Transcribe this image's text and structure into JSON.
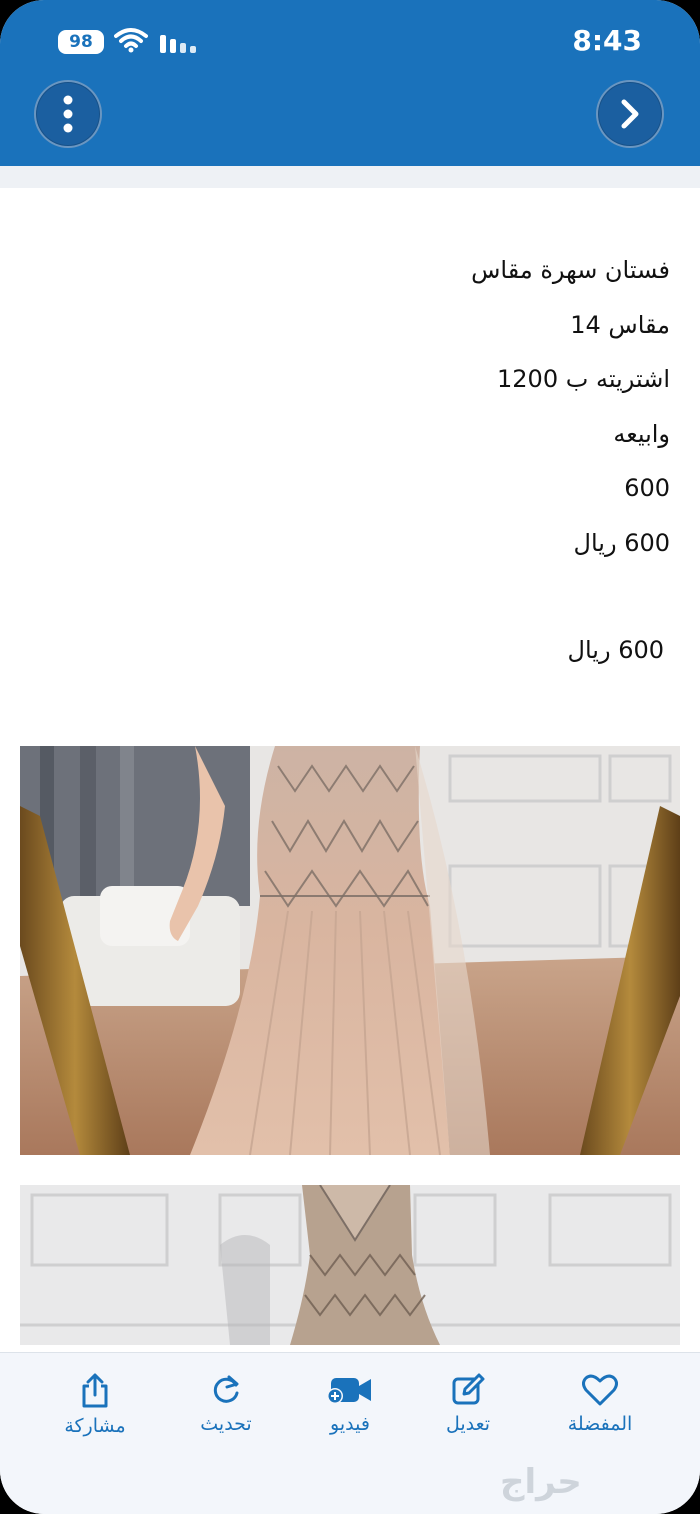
{
  "status_bar": {
    "time": "8:43",
    "battery": "98"
  },
  "header": {
    "menu_icon": "more-vertical-icon",
    "forward_icon": "chevron-right-icon"
  },
  "description": {
    "lines": [
      "فستان سهرة مقاس",
      "مقاس 14",
      "اشتريته ب 1200",
      "وابيعه",
      "600",
      "600 ريال"
    ]
  },
  "price": "600 ريال",
  "photos": [
    {
      "alt": "evening-dress-photo-1"
    },
    {
      "alt": "evening-dress-photo-2"
    }
  ],
  "tabbar": {
    "favorite": {
      "label": "المفضلة",
      "icon": "heart-icon"
    },
    "edit": {
      "label": "تعديل",
      "icon": "edit-icon"
    },
    "video": {
      "label": "فيديو",
      "icon": "video-add-icon"
    },
    "refresh": {
      "label": "تحديث",
      "icon": "refresh-icon"
    },
    "share": {
      "label": "مشاركة",
      "icon": "share-icon"
    }
  },
  "watermark": "حراج",
  "colors": {
    "header": "#1a72bb",
    "accent": "#1a72bb"
  }
}
